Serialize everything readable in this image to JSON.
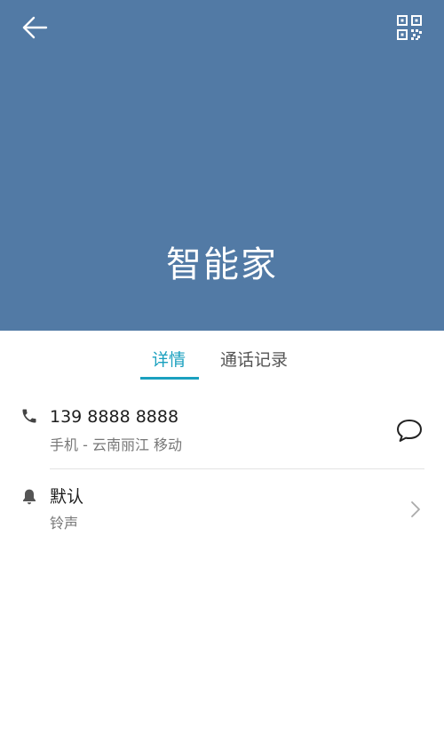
{
  "header": {
    "contact_name": "智能家",
    "background_color": "#527aa5",
    "back_icon": "arrow-left-icon",
    "qr_icon": "qr-code-icon"
  },
  "tabs": {
    "items": [
      {
        "label": "详情",
        "selected": true
      },
      {
        "label": "通话记录",
        "selected": false
      }
    ],
    "accent_color": "#1aa0bf"
  },
  "phone": {
    "icon": "phone-icon",
    "number": "139 8888 8888",
    "detail": "手机 - 云南丽江 移动",
    "action_icon": "message-icon"
  },
  "ringtone": {
    "icon": "bell-icon",
    "value": "默认",
    "label": "铃声",
    "action_icon": "chevron-right-icon"
  }
}
